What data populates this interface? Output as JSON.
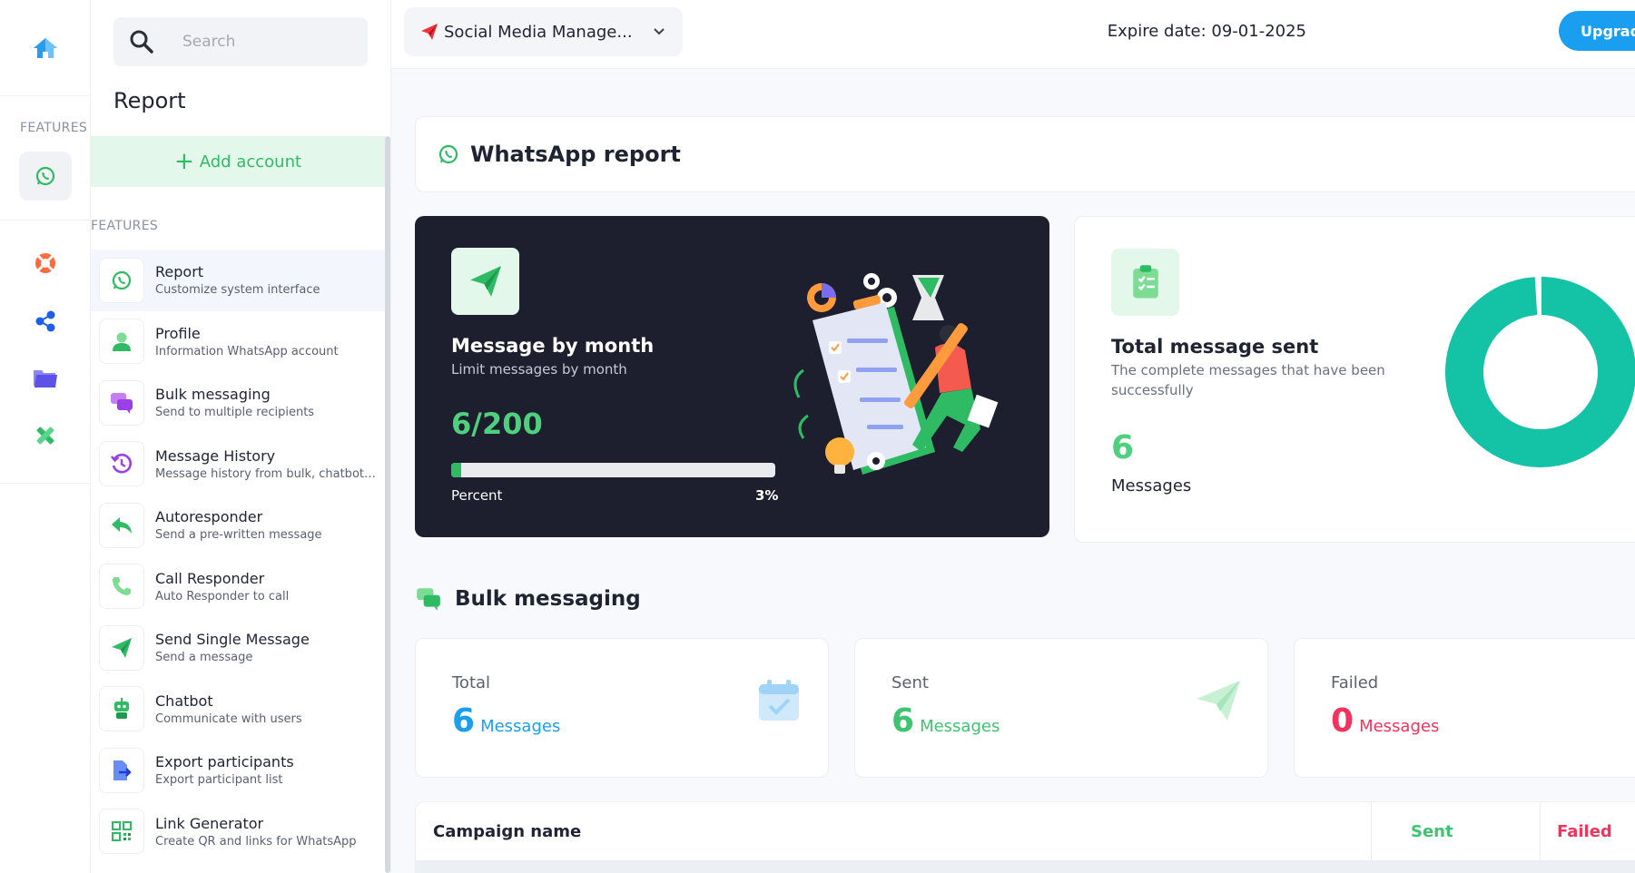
{
  "rail": {
    "section_label": "FEATURES"
  },
  "sidebar": {
    "search_placeholder": "Search",
    "title": "Report",
    "add_account_label": "Add account",
    "features_label": "FEATURES",
    "items": [
      {
        "title": "Report",
        "desc": "Customize system interface",
        "icon": "whatsapp-icon"
      },
      {
        "title": "Profile",
        "desc": "Information WhatsApp account",
        "icon": "user-icon"
      },
      {
        "title": "Bulk messaging",
        "desc": "Send to multiple recipients",
        "icon": "chat-bubbles-icon"
      },
      {
        "title": "Message History",
        "desc": "Message history from bulk, chatbot and more",
        "icon": "history-icon"
      },
      {
        "title": "Autoresponder",
        "desc": "Send a pre-written message",
        "icon": "reply-icon"
      },
      {
        "title": "Call Responder",
        "desc": "Auto Responder to call",
        "icon": "phone-icon"
      },
      {
        "title": "Send Single Message",
        "desc": "Send a message",
        "icon": "paper-plane-icon"
      },
      {
        "title": "Chatbot",
        "desc": "Communicate with users",
        "icon": "robot-icon"
      },
      {
        "title": "Export participants",
        "desc": "Export participant list",
        "icon": "export-file-icon"
      },
      {
        "title": "Link Generator",
        "desc": "Create QR and links for WhatsApp",
        "icon": "qr-code-icon"
      }
    ]
  },
  "topbar": {
    "project_name": "Social Media Manage...",
    "expire_text": "Expire date: 09-01-2025",
    "upgrade_label": "Upgrade"
  },
  "report": {
    "title": "WhatsApp report"
  },
  "month_card": {
    "title": "Message by month",
    "subtitle": "Limit messages by month",
    "count_text": "6/200",
    "percent_label": "Percent",
    "percent_text": "3%",
    "progress_fraction": 0.03
  },
  "total_card": {
    "title": "Total message sent",
    "subtitle": "The complete messages that have been successfully",
    "count": "6",
    "unit": "Messages",
    "donut_sent_fraction": 0.99
  },
  "bulk": {
    "title": "Bulk messaging",
    "stats": [
      {
        "label": "Total",
        "value": "6",
        "unit": "Messages",
        "color": "#1a9ff0",
        "icon": "calendar-check-icon"
      },
      {
        "label": "Sent",
        "value": "6",
        "unit": "Messages",
        "color": "#3ec471",
        "icon": "paper-plane-icon"
      },
      {
        "label": "Failed",
        "value": "0",
        "unit": "Messages",
        "color": "#f2335d",
        "icon": "failed-icon"
      }
    ]
  },
  "table": {
    "col_campaign": "Campaign name",
    "col_sent": "Sent",
    "col_failed": "Failed"
  },
  "colors": {
    "accent_green": "#2fbb63",
    "accent_blue": "#1a9ff0",
    "danger": "#f2335d",
    "dark_card": "#1d1f2e",
    "donut": "#14c2a6"
  }
}
